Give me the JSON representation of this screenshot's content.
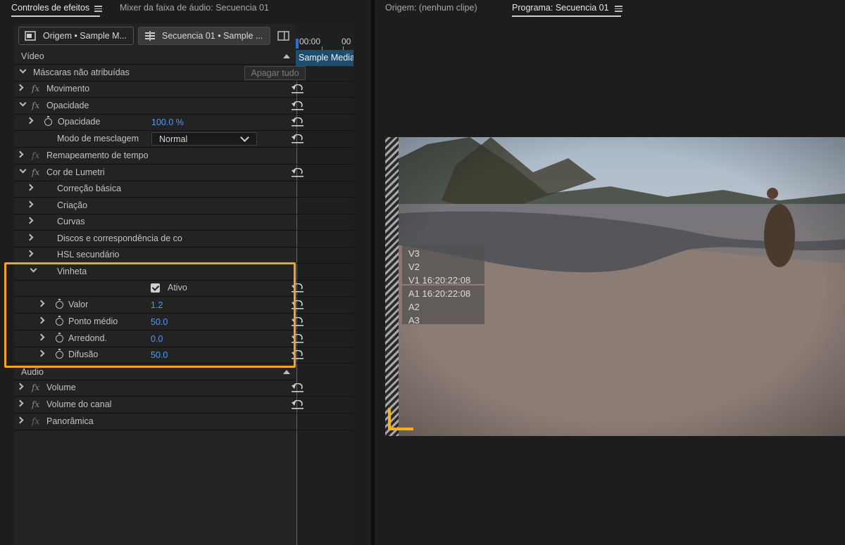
{
  "header": {
    "tabs_left": [
      "Controles de efeitos",
      "Mixer da faixa de áudio: Secuencia 01"
    ],
    "tabs_right": [
      "Origem: (nenhum clipe)",
      "Programa: Secuencia 01"
    ]
  },
  "clip_tabs": {
    "source_tab": "Origem • Sample M...",
    "sequence_tab": "Secuencia 01 • Sample ..."
  },
  "timeline": {
    "time1": "00:00",
    "time2": "00",
    "clip_label": "Sample Media"
  },
  "effects": {
    "video_section": "Vídeo",
    "masks_label": "Máscaras não atribuídas",
    "clear_all_button": "Apagar tudo",
    "motion": "Movimento",
    "opacity_group": "Opacidade",
    "opacity_param": "Opacidade",
    "opacity_value": "100.0 %",
    "blend_mode_label": "Modo de mesclagem",
    "blend_mode_value": "Normal",
    "time_remap": "Remapeamento de tempo",
    "lumetri": "Cor de Lumetri",
    "basic_correction": "Correção básica",
    "creative": "Criação",
    "curves": "Curvas",
    "wheels": "Discos e correspondência de co",
    "hsl": "HSL secundário",
    "vignette": "Vinheta",
    "active_label": "Ativo",
    "amount_label": "Valor",
    "amount_value": "1.2",
    "midpoint_label": "Ponto médio",
    "midpoint_value": "50.0",
    "roundness_label": "Arredond.",
    "roundness_value": "0.0",
    "feather_label": "Difusão",
    "feather_value": "50.0",
    "audio_section": "Áudio",
    "volume": "Volume",
    "channel_volume": "Volume do canal",
    "panner": "Panorâmica"
  },
  "program_overlay": {
    "video_tracks": "V3\nV2\nV1 16:20:22:08",
    "audio_tracks": "A1 16:20:22:08\nA2\nA3"
  },
  "colors": {
    "accent_blue": "#4c9aff",
    "highlight_orange": "#f7a41d",
    "marker_yellow": "#f0b21e"
  }
}
